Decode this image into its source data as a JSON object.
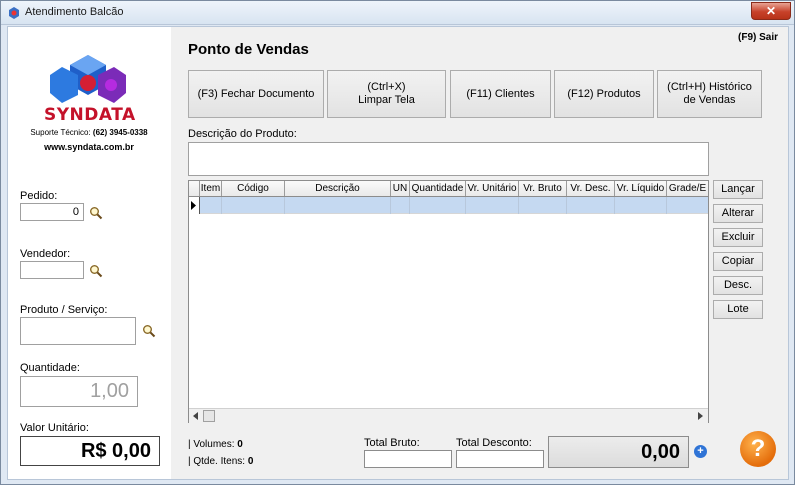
{
  "window": {
    "title": "Atendimento Balcão",
    "close_label": "✕"
  },
  "brand": {
    "name": "SYNDATA",
    "support_label": "Suporte Técnico:",
    "support_phone": "(62) 3945-0338",
    "website": "www.syndata.com.br"
  },
  "left": {
    "pedido_label": "Pedido:",
    "pedido_value": "0",
    "vendedor_label": "Vendedor:",
    "vendedor_value": "",
    "produto_label": "Produto / Serviço:",
    "produto_value": "",
    "quantidade_label": "Quantidade:",
    "quantidade_value": "1,00",
    "valor_label": "Valor Unitário:",
    "valor_value": "R$ 0,00"
  },
  "main": {
    "title": "Ponto de Vendas",
    "exit_label": "(F9) Sair",
    "buttons": [
      {
        "line1": "(F3) Fechar Documento",
        "line2": ""
      },
      {
        "line1": "(Ctrl+X)",
        "line2": "Limpar Tela"
      },
      {
        "line1": "(F11) Clientes",
        "line2": ""
      },
      {
        "line1": "(F12) Produtos",
        "line2": ""
      },
      {
        "line1": "(Ctrl+H) Histórico",
        "line2": "de Vendas"
      }
    ],
    "description_label": "Descrição do Produto:",
    "description_value": "",
    "grid_columns": [
      "Item",
      "Código",
      "Descrição",
      "UN",
      "Quantidade",
      "Vr. Unitário",
      "Vr. Bruto",
      "Vr. Desc.",
      "Vr. Líquido",
      "Grade/E"
    ],
    "side_buttons": [
      "Lançar",
      "Alterar",
      "Excluir",
      "Copiar",
      "Desc.",
      "Lote"
    ],
    "volumes_label": "| Volumes:",
    "volumes_value": "0",
    "itens_label": "| Qtde. Itens:",
    "itens_value": "0",
    "total_bruto_label": "Total Bruto:",
    "total_bruto_value": "",
    "total_desconto_label": "Total Desconto:",
    "total_desconto_value": "",
    "total_value": "0,00",
    "help_label": "?"
  },
  "colors": {
    "brand_red": "#c4122a",
    "selection_row": "#c5d9f1",
    "help_orange": "#e46d0b",
    "close_red": "#c7422a"
  },
  "icons": [
    "app-icon",
    "magnifier-icon",
    "plus-icon",
    "help-icon",
    "row-indicator-icon"
  ]
}
